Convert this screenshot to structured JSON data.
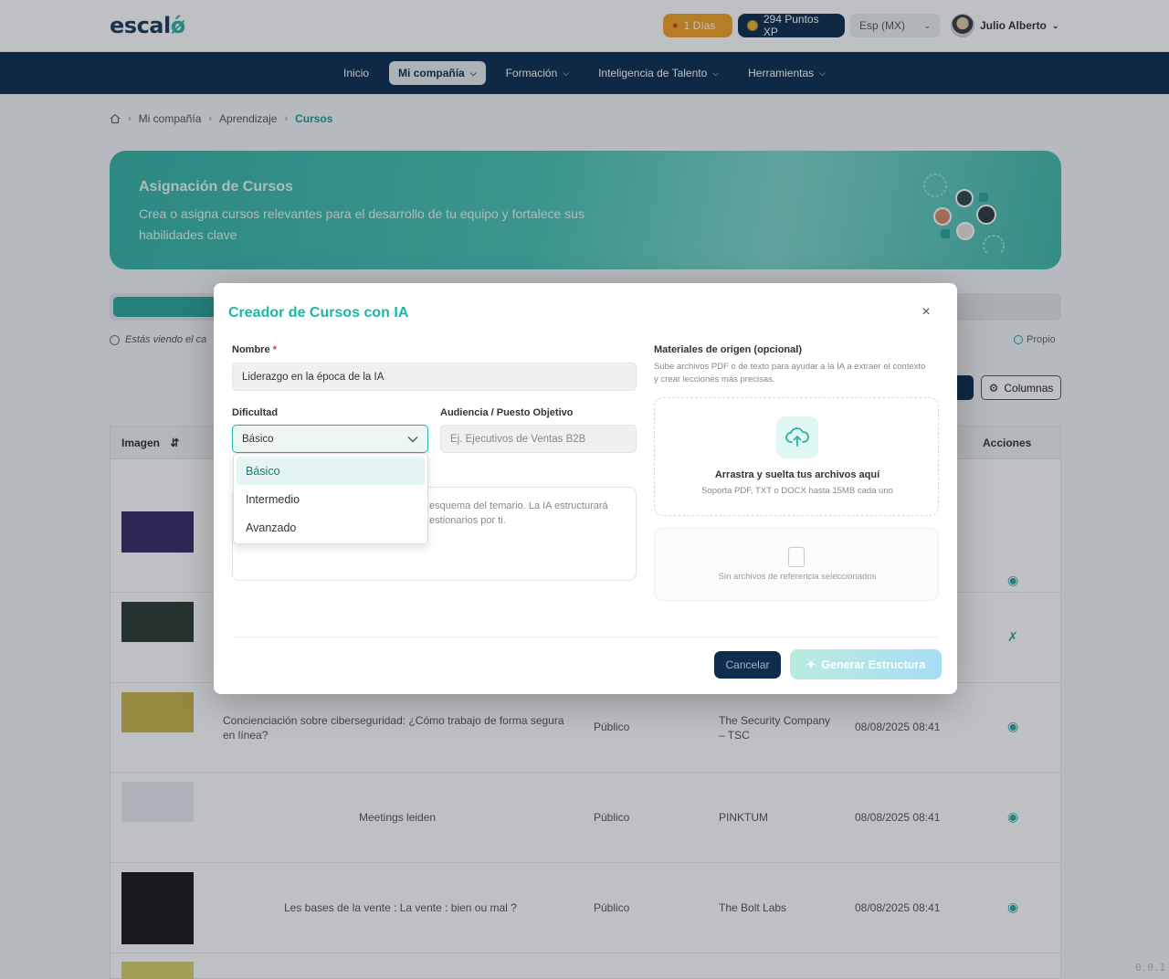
{
  "header": {
    "logo_main": "escal",
    "logo_accent": "ǿ",
    "days_label": "1 Días",
    "xp_label": "294 Puntos XP",
    "language": "Esp (MX)",
    "user_name": "Julio Alberto"
  },
  "nav": {
    "items": [
      {
        "label": "Inicio",
        "active": false,
        "has_menu": false
      },
      {
        "label": "Mi compañía",
        "active": true,
        "has_menu": true
      },
      {
        "label": "Formación",
        "active": false,
        "has_menu": true
      },
      {
        "label": "Inteligencia de Talento",
        "active": false,
        "has_menu": true
      },
      {
        "label": "Herramientas",
        "active": false,
        "has_menu": true
      }
    ]
  },
  "breadcrumb": {
    "items": [
      "Mi compañía",
      "Aprendizaje"
    ],
    "current": "Cursos"
  },
  "hero": {
    "title": "Asignación de Cursos",
    "subtitle": "Crea o asigna cursos relevantes para el desarrollo de tu equipo y fortalece sus habilidades clave"
  },
  "page": {
    "info_text": "Estás viendo el ca",
    "legend_propio": "Propio",
    "columns_button": "Columnas"
  },
  "table": {
    "headers": {
      "image": "Imagen",
      "actions": "Acciones"
    },
    "rows": [
      {
        "title": "",
        "visibility": "",
        "provider": "",
        "date": "",
        "thumb_color": "#3a2a6b",
        "action": "eye-icon"
      },
      {
        "title": "",
        "visibility": "",
        "provider": "",
        "date": "",
        "thumb_color": "#2b3b33",
        "action": "tools-icon"
      },
      {
        "title": "Concienciación sobre ciberseguridad: ¿Cómo trabajo de forma segura en línea?",
        "visibility": "Público",
        "provider": "The Security Company – TSC",
        "date": "08/08/2025 08:41",
        "thumb_color": "#c8b34a",
        "action": "eye-icon"
      },
      {
        "title": "Meetings leiden",
        "visibility": "Público",
        "provider": "PINKTUM",
        "date": "08/08/2025 08:41",
        "thumb_color": "#e9eef3",
        "action": "eye-icon"
      },
      {
        "title": "Les bases de la vente : La vente : bien ou mal ?",
        "visibility": "Público",
        "provider": "The Bolt Labs",
        "date": "08/08/2025 08:41",
        "thumb_color": "#1a1a1a",
        "action": "eye-icon"
      }
    ]
  },
  "modal": {
    "title": "Creador de Cursos con IA",
    "name_label": "Nombre",
    "name_value": "Liderazgo en la época de la IA",
    "difficulty_label": "Dificultad",
    "difficulty_value": "Básico",
    "difficulty_options": [
      "Básico",
      "Intermedio",
      "Avanzado"
    ],
    "audience_label": "Audiencia / Puesto Objetivo",
    "audience_placeholder": "Ej. Ejecutivos de Ventas B2B",
    "textarea_hint": "esquema del temario. La IA estructurará estionarios por ti.",
    "materials_title": "Materiales de origen (opcional)",
    "materials_sub": "Sube archivos PDF o de texto para ayudar a la IA a extraer el contexto y crear lecciones más precisas.",
    "dropzone_title": "Arrastra y suelta tus archivos aquí",
    "dropzone_sub": "Soporta PDF, TXT o DOCX hasta 15MB cada uno",
    "no_files_text": "Sin archivos de referencia seleccionados",
    "cancel_label": "Cancelar",
    "generate_label": "Generar Estructura"
  },
  "footer": {
    "version": "0.0.1"
  },
  "colors": {
    "brand_teal": "#1fb5a6",
    "navy": "#0d2d4e",
    "streak_orange": "#f3a325"
  }
}
